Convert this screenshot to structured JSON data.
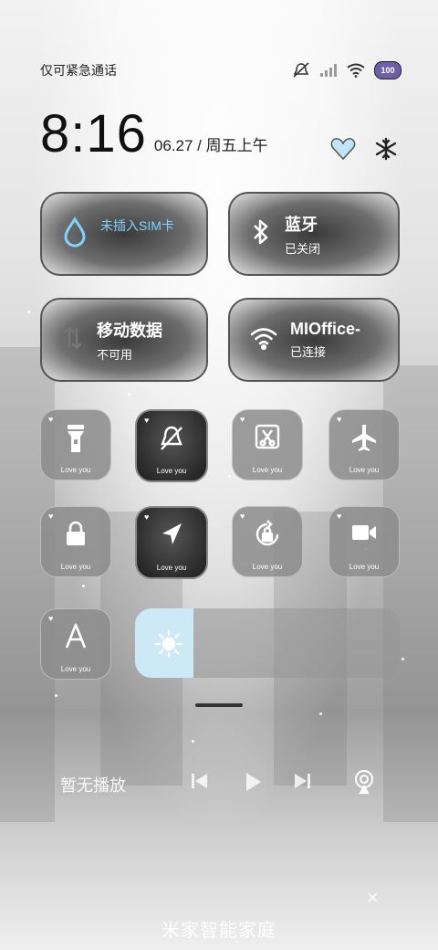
{
  "status_bar": {
    "carrier": "仅可紧急通话",
    "battery": "100"
  },
  "clock": {
    "time": "8:16",
    "date": "06.27 / 周五上午"
  },
  "tiles": {
    "sim": {
      "label": "未插入SIM卡"
    },
    "bluetooth": {
      "title": "蓝牙",
      "subtitle": "已关闭"
    },
    "mobile_data": {
      "title": "移动数据",
      "subtitle": "不可用"
    },
    "wifi": {
      "title": "MIOffice-",
      "subtitle": "已连接"
    }
  },
  "toggle_caption": "Love you",
  "toggles": [
    {
      "icon": "flashlight-icon",
      "state": "off"
    },
    {
      "icon": "mute-bell-icon",
      "state": "on"
    },
    {
      "icon": "screenshot-icon",
      "state": "off"
    },
    {
      "icon": "airplane-icon",
      "state": "off"
    },
    {
      "icon": "lock-icon",
      "state": "off"
    },
    {
      "icon": "location-icon",
      "state": "on"
    },
    {
      "icon": "rotation-lock-icon",
      "state": "off"
    },
    {
      "icon": "video-camera-icon",
      "state": "off"
    },
    {
      "icon": "auto-brightness-icon",
      "state": "off"
    }
  ],
  "brightness": {
    "level_percent": 22
  },
  "media": {
    "title": "暂无播放"
  },
  "home_panel": {
    "title": "米家智能家庭",
    "close": "×"
  },
  "colors": {
    "brightness_fill": "#cde9f6",
    "sim_accent": "#7fd3ff"
  }
}
